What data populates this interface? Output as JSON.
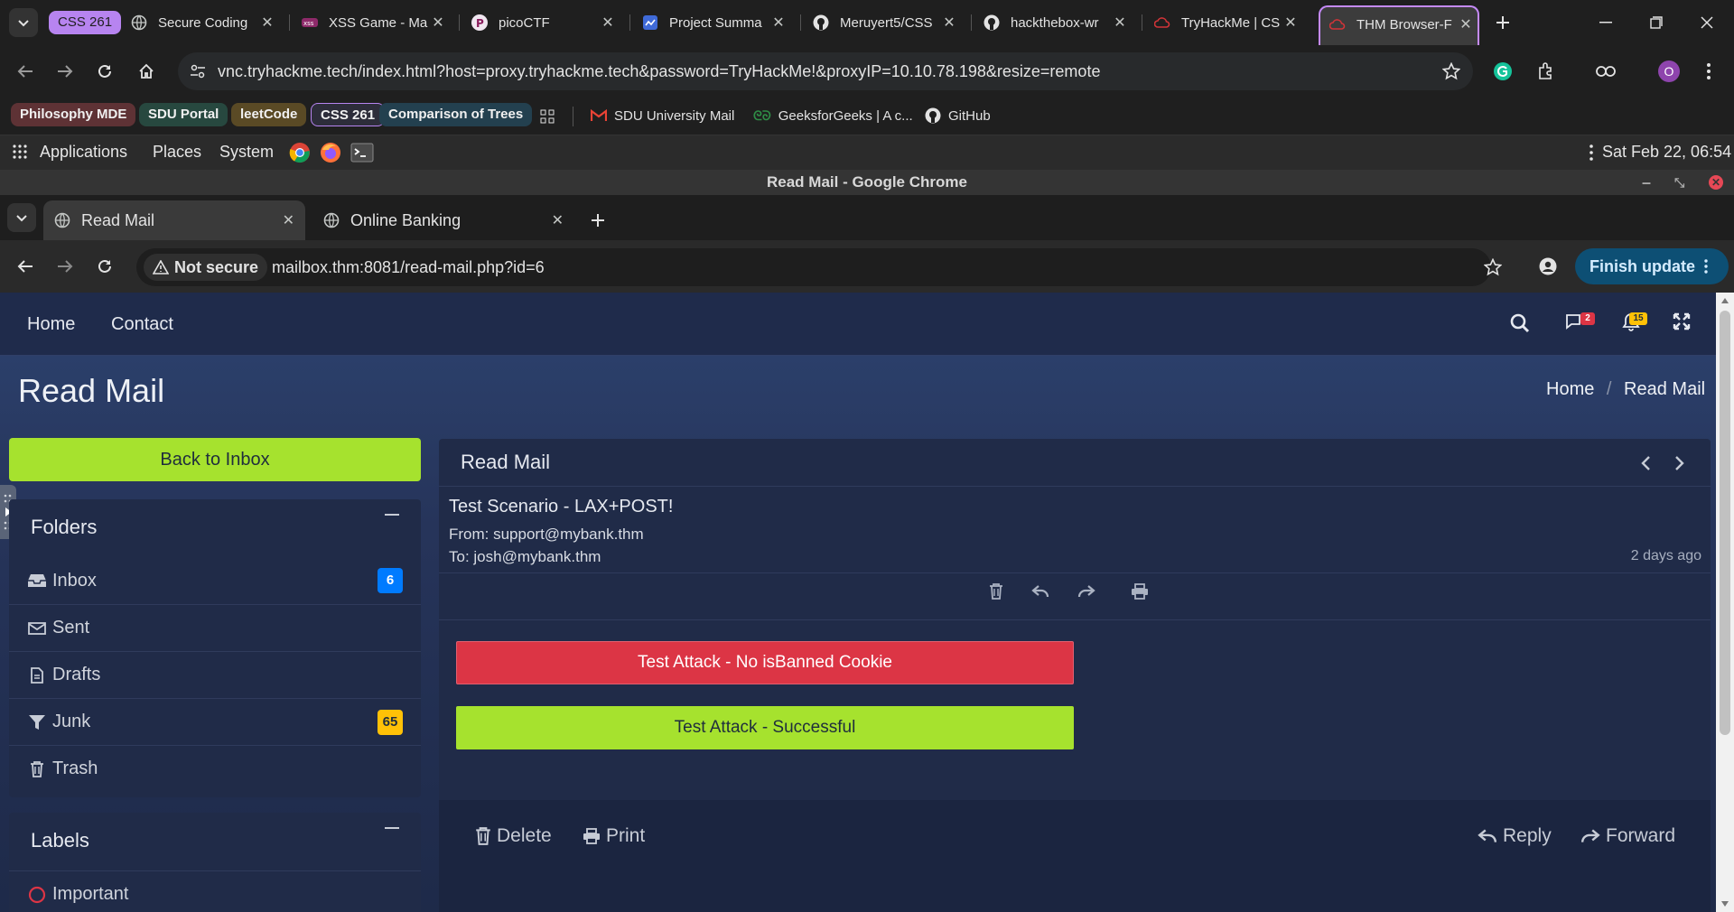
{
  "outer_tabs": [
    {
      "label": "CSS 261"
    },
    {
      "label": "Secure Coding"
    },
    {
      "label": "XSS Game - Ma"
    },
    {
      "label": "picoCTF"
    },
    {
      "label": "Project Summa"
    },
    {
      "label": "Meruyert5/CSS"
    },
    {
      "label": "hackthebox-wr"
    },
    {
      "label": "TryHackMe | CS"
    },
    {
      "label": "THM Browser-F"
    }
  ],
  "outer_url": "vnc.tryhackme.tech/index.html?host=proxy.tryhackme.tech&password=TryHackMe!&proxyIP=10.10.78.198&resize=remote",
  "profile_initial": "O",
  "bookmarks": {
    "chips": [
      "Philosophy MDE",
      "SDU Portal",
      "leetCode",
      "CSS 261",
      "Comparison of Trees"
    ],
    "links": [
      "SDU University Mail",
      "GeeksforGeeks | A c...",
      "GitHub"
    ]
  },
  "panel": {
    "applications": "Applications",
    "places": "Places",
    "system": "System",
    "clock": "Sat Feb 22, 06:54"
  },
  "window_title": "Read Mail - Google Chrome",
  "inner_tabs": [
    {
      "label": "Read Mail"
    },
    {
      "label": "Online Banking"
    }
  ],
  "inner_security": "Not secure",
  "inner_url": "mailbox.thm:8081/read-mail.php?id=6",
  "finish_update": "Finish update",
  "site": {
    "nav": {
      "home": "Home",
      "contact": "Contact"
    },
    "message_badge": "2",
    "notif_badge": "15",
    "page_title": "Read Mail",
    "breadcrumb": {
      "home": "Home",
      "sep": "/",
      "current": "Read Mail"
    },
    "back_button": "Back to Inbox",
    "folders": {
      "title": "Folders",
      "items": [
        {
          "label": "Inbox",
          "badge": "6"
        },
        {
          "label": "Sent"
        },
        {
          "label": "Drafts"
        },
        {
          "label": "Junk",
          "badge": "65"
        },
        {
          "label": "Trash"
        }
      ]
    },
    "labels": {
      "title": "Labels",
      "items": [
        {
          "label": "Important"
        }
      ]
    },
    "mail": {
      "header": "Read Mail",
      "subject": "Test Scenario - LAX+POST!",
      "from": "From: support@mybank.thm",
      "to": "To: josh@mybank.thm",
      "time": "2 days ago",
      "btn_fail": "Test Attack - No isBanned Cookie",
      "btn_success": "Test Attack - Successful",
      "footer": {
        "delete": "Delete",
        "print": "Print",
        "reply": "Reply",
        "forward": "Forward"
      }
    }
  },
  "colors": {
    "accent_purple": "#c58af9",
    "lime": "#a6e22e",
    "danger": "#dc3545",
    "info_badge": "#007bff",
    "warning_badge": "#ffc107"
  }
}
